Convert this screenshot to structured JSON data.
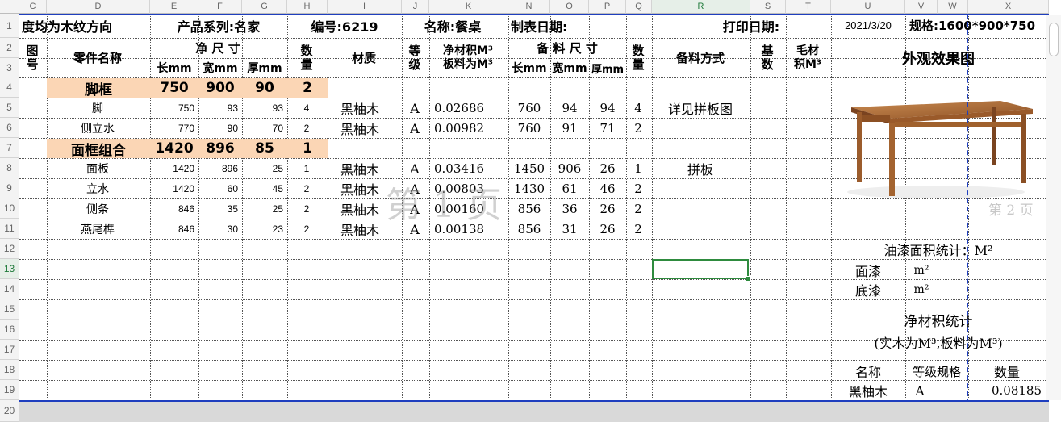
{
  "columns": [
    "C",
    "D",
    "E",
    "F",
    "G",
    "H",
    "I",
    "J",
    "K",
    "N",
    "O",
    "P",
    "Q",
    "R",
    "S",
    "T",
    "U",
    "V",
    "W",
    "X"
  ],
  "selected_column": "R",
  "rows": [
    "1",
    "2",
    "3",
    "4",
    "5",
    "6",
    "7",
    "8",
    "9",
    "10",
    "11",
    "12",
    "13",
    "14",
    "15",
    "16",
    "17",
    "18",
    "19",
    "20"
  ],
  "selected_row": "13",
  "title_row": {
    "grain": "度均为木纹方向",
    "series": "产品系列:名家",
    "code": "编号:6219",
    "name": "名称:餐桌",
    "made_date": "制表日期:",
    "print_date": "打印日期:",
    "date_value": "2021/3/20",
    "spec": "规格:1600*900*750"
  },
  "header": {
    "fig_no_1": "图",
    "fig_no_2": "号",
    "part_name": "零件名称",
    "net_size": "净 尺 寸",
    "len": "长mm",
    "wid": "宽mm",
    "thk": "厚mm",
    "qty_1": "数",
    "qty_2": "量",
    "material": "材质",
    "grade_1": "等",
    "grade_2": "级",
    "volume_1": "净材积M³",
    "volume_2": "板料为M³",
    "prep_size": "备 料 尺 寸",
    "p_len": "长mm",
    "p_wid": "宽mm",
    "p_thk": "厚mm",
    "p_qty_1": "数",
    "p_qty_2": "量",
    "method": "备料方式",
    "base_1": "基",
    "base_2": "数",
    "rough_1": "毛材",
    "rough_2": "积M³",
    "appearance": "外观效果图"
  },
  "groups": [
    {
      "name": "脚框",
      "len": "750",
      "wid": "900",
      "thk": "90",
      "qty": "2"
    },
    {
      "name": "面框组合",
      "len": "1420",
      "wid": "896",
      "thk": "85",
      "qty": "1"
    }
  ],
  "parts": [
    {
      "name": "脚",
      "len": "750",
      "wid": "93",
      "thk": "93",
      "qty": "4",
      "material": "黑柚木",
      "grade": "A",
      "volume": "0.02686",
      "plen": "760",
      "pwid": "94",
      "pthk": "94",
      "pqty": "4",
      "method": "详见拼板图"
    },
    {
      "name": "侧立水",
      "len": "770",
      "wid": "90",
      "thk": "70",
      "qty": "2",
      "material": "黑柚木",
      "grade": "A",
      "volume": "0.00982",
      "plen": "760",
      "pwid": "91",
      "pthk": "71",
      "pqty": "2",
      "method": ""
    },
    {
      "name": "面板",
      "len": "1420",
      "wid": "896",
      "thk": "25",
      "qty": "1",
      "material": "黑柚木",
      "grade": "A",
      "volume": "0.03416",
      "plen": "1450",
      "pwid": "906",
      "pthk": "26",
      "pqty": "1",
      "method": "拼板"
    },
    {
      "name": "立水",
      "len": "1420",
      "wid": "60",
      "thk": "45",
      "qty": "2",
      "material": "黑柚木",
      "grade": "A",
      "volume": "0.00803",
      "plen": "1430",
      "pwid": "61",
      "pthk": "46",
      "pqty": "2",
      "method": ""
    },
    {
      "name": "侧条",
      "len": "846",
      "wid": "35",
      "thk": "25",
      "qty": "2",
      "material": "黑柚木",
      "grade": "A",
      "volume": "0.00160",
      "plen": "856",
      "pwid": "36",
      "pthk": "26",
      "pqty": "2",
      "method": ""
    },
    {
      "name": "燕尾榫",
      "len": "846",
      "wid": "30",
      "thk": "23",
      "qty": "2",
      "material": "黑柚木",
      "grade": "A",
      "volume": "0.00138",
      "plen": "856",
      "pwid": "31",
      "pthk": "26",
      "pqty": "2",
      "method": ""
    }
  ],
  "paint": {
    "title": "油漆面积统计：M²",
    "top_coat": "面漆",
    "base_coat": "底漆",
    "unit": "m²"
  },
  "volume_stats": {
    "title": "净材积统计",
    "subtitle": "(实木为M³,板料为M³)",
    "col_name": "名称",
    "col_grade_spec": "等级规格",
    "col_qty": "数量",
    "row_name": "黑柚木",
    "row_grade": "A",
    "row_qty": "0.08185"
  },
  "watermark": "第 1 页",
  "page_label": "第 2 页",
  "colors": {
    "group_fill": "#fbd6b5",
    "selection": "#2e8b3e",
    "page_break": "#1f3fbf"
  }
}
